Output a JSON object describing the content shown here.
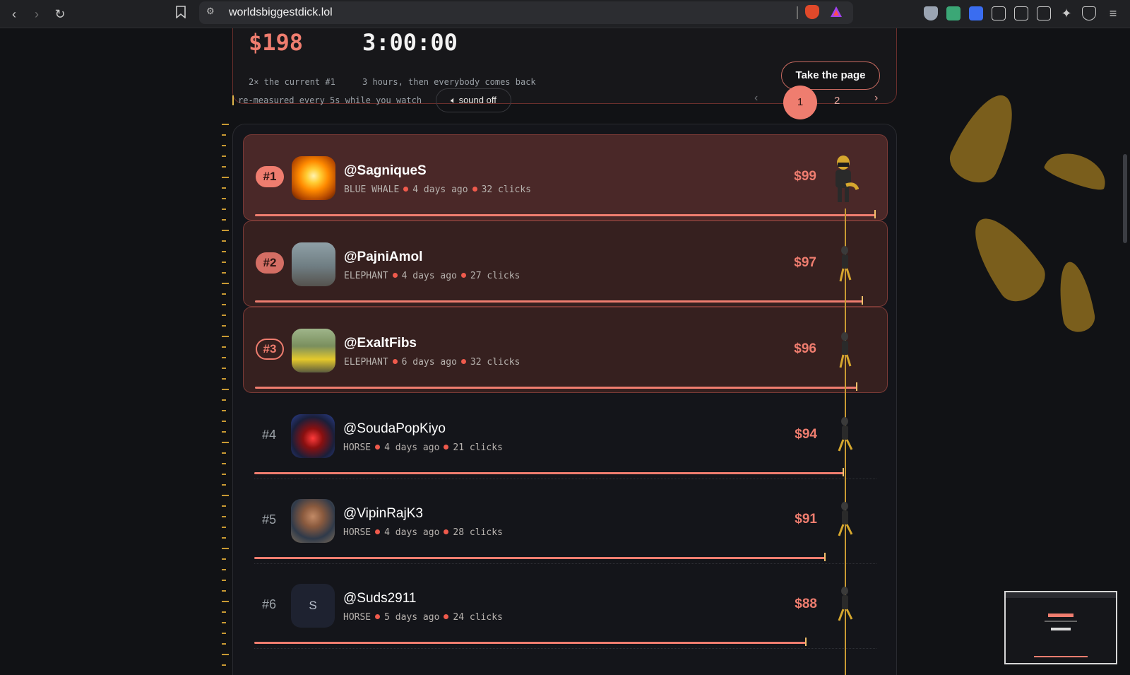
{
  "browser": {
    "url": "worldsbiggestdick.lol"
  },
  "hero": {
    "price": "$198",
    "price_sub": "2× the current #1",
    "timer": "3:00:00",
    "timer_sub": "3 hours, then everybody comes back",
    "cta": "Take the page"
  },
  "toolbar": {
    "measure_text": "re-measured every 5s while you watch",
    "sound_label": "sound off"
  },
  "pagination": {
    "prev": "‹",
    "pages": [
      "1",
      "2"
    ],
    "current": "1",
    "next": "›"
  },
  "rows": [
    {
      "rank": "#1",
      "handle": "@SagniqueS",
      "tier": "BLUE WHALE",
      "time": "4 days ago",
      "clicks": "32 clicks",
      "amount": "$99",
      "bar_fraction": 1.0
    },
    {
      "rank": "#2",
      "handle": "@PajniAmol",
      "tier": "ELEPHANT",
      "time": "4 days ago",
      "clicks": "27 clicks",
      "amount": "$97",
      "bar_fraction": 0.98
    },
    {
      "rank": "#3",
      "handle": "@ExaltFibs",
      "tier": "ELEPHANT",
      "time": "6 days ago",
      "clicks": "32 clicks",
      "amount": "$96",
      "bar_fraction": 0.97
    },
    {
      "rank": "#4",
      "handle": "@SoudaPopKiyo",
      "tier": "HORSE",
      "time": "4 days ago",
      "clicks": "21 clicks",
      "amount": "$94",
      "bar_fraction": 0.95
    },
    {
      "rank": "#5",
      "handle": "@VipinRajK3",
      "tier": "HORSE",
      "time": "4 days ago",
      "clicks": "28 clicks",
      "amount": "$91",
      "bar_fraction": 0.92
    },
    {
      "rank": "#6",
      "handle": "@Suds2911",
      "tier": "HORSE",
      "time": "5 days ago",
      "clicks": "24 clicks",
      "amount": "$88",
      "bar_fraction": 0.89,
      "avatar_letter": "S"
    }
  ],
  "colors": {
    "accent": "#ef7d6f",
    "rope": "#c99a33",
    "background": "#111215"
  },
  "icons": {
    "back": "back-icon",
    "forward": "forward-icon",
    "reload": "reload-icon",
    "bookmark": "bookmark-icon",
    "mute": "mute-icon"
  }
}
